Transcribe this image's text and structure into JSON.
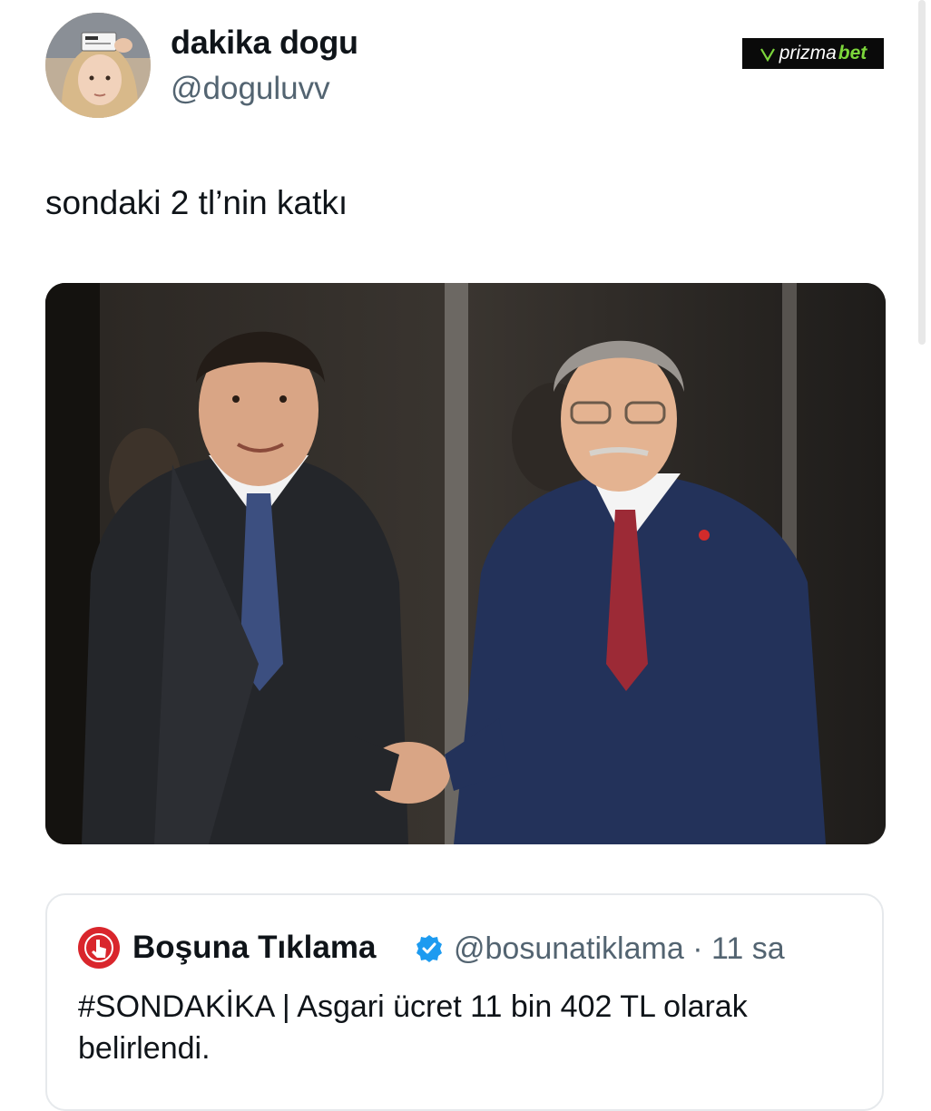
{
  "tweet": {
    "author": {
      "display_name": "dakika dogu",
      "handle": "@doguluvv"
    },
    "text": "sondaki 2 tl’nin katkı",
    "media": {
      "type": "photo"
    }
  },
  "watermark": {
    "prefix": "prizma",
    "suffix": "bet",
    "accent_color": "#7cd63b"
  },
  "quoted_tweet": {
    "display_name": "Boşuna Tıklama",
    "handle": "@bosunatiklama",
    "separator": "·",
    "time": "11 sa",
    "text": "#SONDAKİKA | Asgari ücret 11 bin 402 TL olarak belirlendi.",
    "verified_color": "#1d9bf0",
    "avatar_color": "#d9262c"
  }
}
